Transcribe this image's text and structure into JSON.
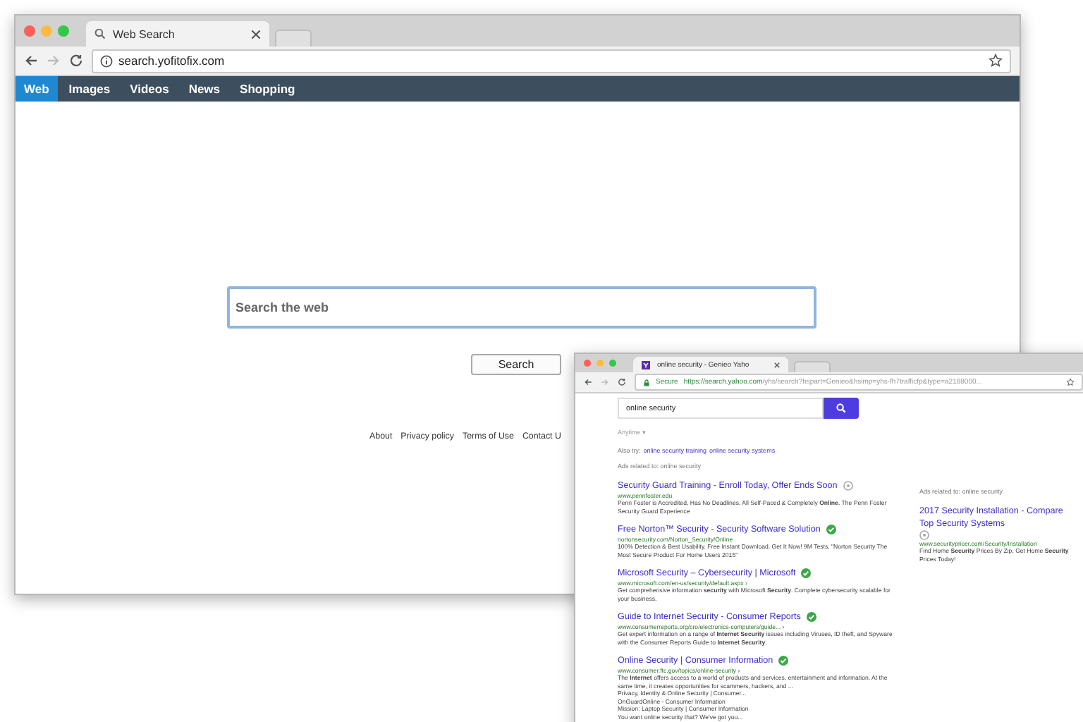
{
  "main_window": {
    "tab": {
      "title": "Web Search"
    },
    "address": "search.yofitofix.com",
    "nav": [
      {
        "label": "Web",
        "selected": true
      },
      {
        "label": "Images",
        "selected": false
      },
      {
        "label": "Videos",
        "selected": false
      },
      {
        "label": "News",
        "selected": false
      },
      {
        "label": "Shopping",
        "selected": false
      }
    ],
    "search": {
      "placeholder": "Search the web",
      "button": "Search"
    },
    "footer_links": [
      "About",
      "Privacy policy",
      "Terms of Use",
      "Contact U"
    ]
  },
  "results_window": {
    "tab": {
      "title": "online security - Genieo Yaho"
    },
    "secure_label": "Secure",
    "address_host": "https://search.yahoo.com",
    "address_rest": "/yhs/search?hspart=Genieo&hsimp=yhs-fh7trafficfp&type=a2188000...",
    "search": {
      "value": "online security"
    },
    "time_filter": "Anytime ▾",
    "also_try": {
      "label": "Also try:",
      "links": [
        "online security training",
        "online security systems"
      ]
    },
    "ads_label": "Ads related to: online security",
    "results": [
      {
        "title": "Security Guard Training - Enroll Today, Offer Ends Soon",
        "verified": false,
        "url": "www.pennfoster.edu",
        "snippet": "Penn Foster is Accredited, Has No Deadlines, All Self-Paced & Completely **Online**. The Penn Foster Security Guard Experience"
      },
      {
        "title": "Free Norton™ Security - Security Software Solution",
        "verified": true,
        "url": "nortonsecurity.com/Norton_Security/Online",
        "snippet": "100% Detection & Best Usability. Free Instant Download. Get It Now! 9M Tests, \"Norton Security The Most Secure Product For Home Users 2015\""
      },
      {
        "title": "Microsoft Security – Cybersecurity | Microsoft",
        "verified": true,
        "url": "www.microsoft.com/en-us/security/default.aspx ›",
        "snippet": "Get comprehensive information **security** with Microsoft **Security**. Complete cybersecurity scalable for your business."
      },
      {
        "title": "Guide to Internet Security - Consumer Reports",
        "verified": true,
        "url": "www.consumerreports.org/cro/electronics-computers/guide... ›",
        "snippet": "Get expert information on a range of **Internet Security** issues including Viruses, ID theft, and Spyware with the Consumer Reports Guide to **Internet Security**."
      },
      {
        "title": "Online Security | Consumer Information",
        "verified": true,
        "url": "www.consumer.ftc.gov/topics/online-security ›",
        "snippet": "The **Internet** offers access to a world of products and services, entertainment and information. At the same time, it creates opportunities for scammers, hackers, and ...",
        "links": [
          "Privacy, Identity & Online Security | Consumer...",
          "OnGuardOnline - Consumer Information",
          "Mission: Laptop Security | Consumer Information",
          "You want online security that? We've got you..."
        ]
      }
    ],
    "side_ads_label": "Ads related to: online security",
    "side_ad": {
      "title": "2017 Security Installation - Compare Top Security Systems",
      "verified": false,
      "url": "www.securitypricer.com/Security/Installation",
      "snippet": "Find Home **Security** Prices By Zip. Get Home **Security** Prices Today!"
    }
  }
}
